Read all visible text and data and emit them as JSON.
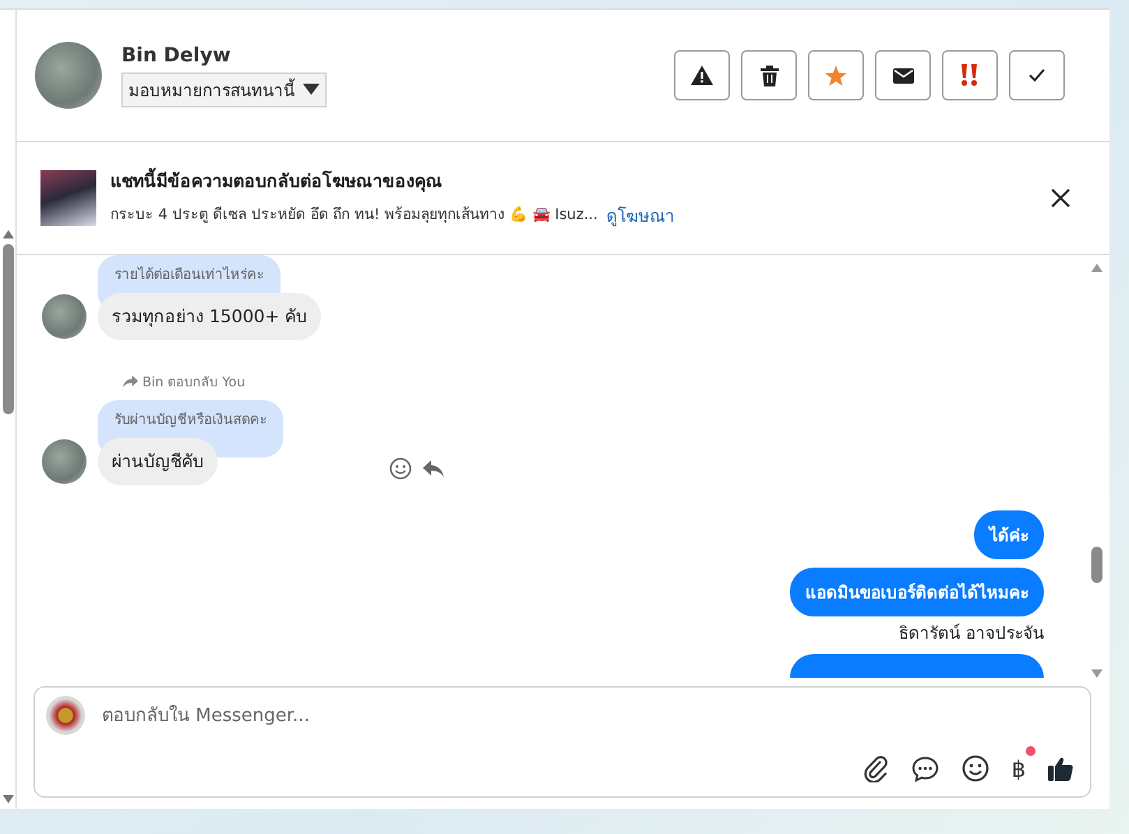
{
  "header": {
    "contact_name": "Bin Delyw",
    "assign_dropdown": "มอบหมายการสนทนานี้",
    "actions": [
      {
        "kind": "warning"
      },
      {
        "kind": "trash"
      },
      {
        "kind": "star"
      },
      {
        "kind": "envelope"
      },
      {
        "kind": "urgent"
      },
      {
        "kind": "check"
      }
    ]
  },
  "ad_banner": {
    "title": "แชทนี้มีข้อความตอบกลับต่อโฆษณาของคุณ",
    "description": "กระบะ 4 ประตู ดีเซล ประหยัด อึด ถึก ทน! พร้อมลุยทุกเส้นทาง 💪 🚘 Isuz...",
    "link": "ดูโฆษณา"
  },
  "messages": [
    {
      "kind": "incoming",
      "quote": "รายได้ต่อเดือนเท่าไหร่คะ",
      "text": "รวมทุกอย่าง 15000+ คับ",
      "show_actions": false
    },
    {
      "kind": "reply_note",
      "text": "Bin ตอบกลับ You"
    },
    {
      "kind": "incoming",
      "quote": "รับผ่านบัญชีหรือเงินสดคะ",
      "text": "ผ่านบัญชีคับ",
      "show_actions": true
    },
    {
      "kind": "outgoing",
      "text": "ได้ค่ะ"
    },
    {
      "kind": "outgoing",
      "text": "แอดมินขอเบอร์ติดต่อได้ไหมคะ"
    },
    {
      "kind": "sender",
      "text": "ธิดารัตน์ อาจประจัน"
    },
    {
      "kind": "outgoing_partial"
    }
  ],
  "composer": {
    "placeholder": "ตอบกลับใน Messenger...",
    "tools": [
      {
        "kind": "paperclip",
        "notification": false
      },
      {
        "kind": "chat",
        "notification": false
      },
      {
        "kind": "emoji",
        "notification": false
      },
      {
        "kind": "glyph",
        "label": "฿",
        "notification": true
      },
      {
        "kind": "like",
        "notification": false
      }
    ]
  }
}
